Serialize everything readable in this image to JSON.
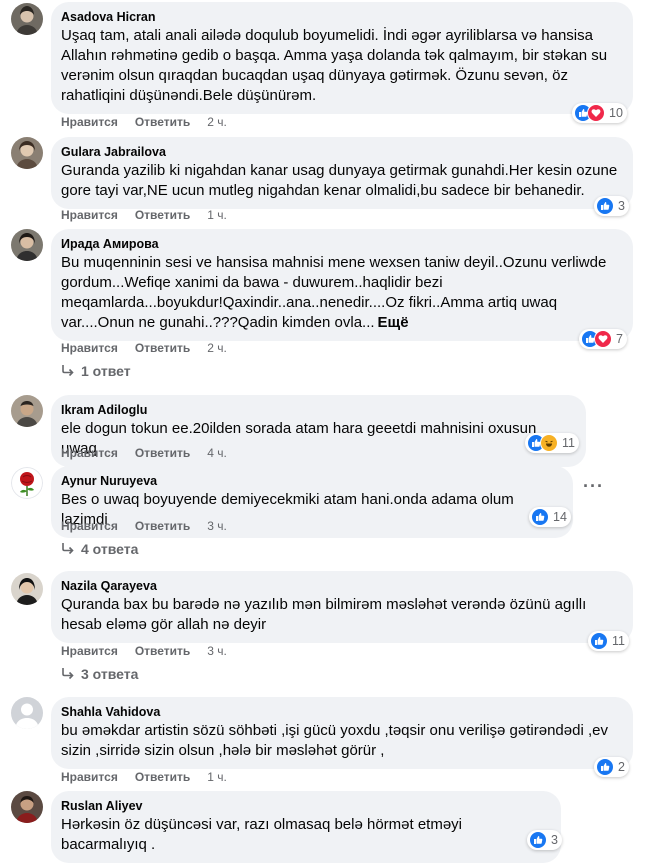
{
  "colors": {
    "like": "#1877f2",
    "love": "#f0284a",
    "haha": "#f7b125",
    "bubble": "#f0f2f5",
    "meta": "#65676b"
  },
  "actions": {
    "like": "Нравится",
    "reply": "Ответить"
  },
  "comments": [
    {
      "author": "Asadova Hicran",
      "text": "Uşaq tam, atali anali ailədə doqulub boyumelidi. İndi əgər ayrilibl­arsa və hansisa Allahın rəhmətinə gedib o başqa. Amma yaşa dolanda tək qalmayım, bir stəkan su verənim olsun qıraqdan bucaqdan uşaq dünyaya gətirmək. Özunu sevən, öz rahatliqini düşünəndi.Bele düşünürəm.",
      "time": "2 ч.",
      "reactions": [
        "like-icon",
        "love-icon"
      ],
      "count": "10"
    },
    {
      "author": "Gulara Jabrailova",
      "text": "Guranda yazilib ki nigahdan kanar usag dunyaya getirmak gunahdi.Her kesin ozune gore tayi var,NE ucun mutleg nigahdan kenar olmalidi,bu sadece bir behanedir.",
      "time": "1 ч.",
      "reactions": [
        "like-icon"
      ],
      "count": "3"
    },
    {
      "author": "Ирада Амирова",
      "text": "Bu muqenninin sesi ve hansisa mahnisi mene wexsen taniw deyil..Ozunu verliwde gordum...Wefiqe xanimi da bawa - duwurem..haqlidir bezi meqamlarda...boyukdur!Qaxindir..ana..nenedir....Oz fikri..Amma artiq uwaq var....Onun ne gunahi..???Qadin kimden ovla...",
      "more": "Ещё",
      "time": "2 ч.",
      "reactions": [
        "like-icon",
        "love-icon"
      ],
      "count": "7",
      "replies": "1 ответ"
    },
    {
      "author": "Ikram Adiloglu",
      "text": "ele dogun tokun ee.20ilden sorada atam hara geeetdi mahnisini oxusun uwaq",
      "time": "4 ч.",
      "reactions": [
        "like-icon",
        "haha-icon"
      ],
      "count": "11"
    },
    {
      "author": "Aynur Nuruyeva",
      "text": "Bes o uwaq boyuyende demiyecekmiki atam hani.onda adama olum lazimdi",
      "time": "3 ч.",
      "reactions": [
        "like-icon"
      ],
      "count": "14",
      "replies": "4 ответа",
      "menu": "···"
    },
    {
      "author": "Nazila Qarayeva",
      "text": "Quranda bax bu barədə nə yazılıb mən bilmirəm məsləhət verəndə özünü agıllı hesab eləmə gör allah nə deyir",
      "time": "3 ч.",
      "reactions": [
        "like-icon"
      ],
      "count": "11",
      "replies": "3 ответа"
    },
    {
      "author": "Shahla Vahidova",
      "text": "bu əməkdar artistin sözü söhbəti ,işi gücü yoxdu ,təqsir onu verilişə gətirəndədi ,ev sizin ,sirridə sizin olsun ,hələ bir məsləhət görür ,",
      "time": "1 ч.",
      "reactions": [
        "like-icon"
      ],
      "count": "2"
    },
    {
      "author": "Ruslan Aliyev",
      "text": "Hərkəsin öz düşüncəsi var, razı olmasaq belə hörmət etməyi bacarmalıyıq .",
      "reactions": [
        "like-icon"
      ],
      "count": "3"
    }
  ]
}
